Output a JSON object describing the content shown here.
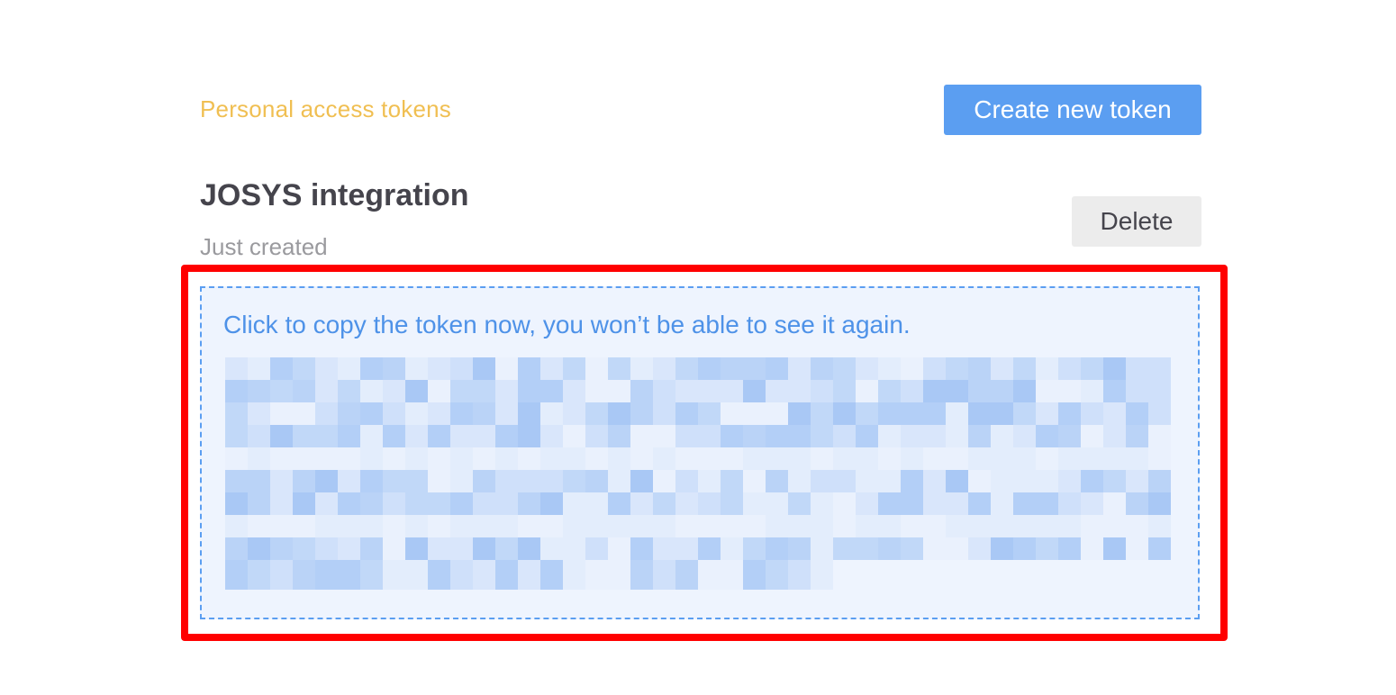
{
  "header": {
    "section_title": "Personal access tokens",
    "create_button_label": "Create new token"
  },
  "token": {
    "name": "JOSYS integration",
    "created": "Just created",
    "delete_button_label": "Delete",
    "copy_hint": "Click to copy the token now, you won’t be able to see it again.",
    "value_redacted": true
  },
  "colors": {
    "accent_blue": "#5b9ef1",
    "title_yellow": "#f0bf52",
    "highlight_red": "#ff0000"
  }
}
